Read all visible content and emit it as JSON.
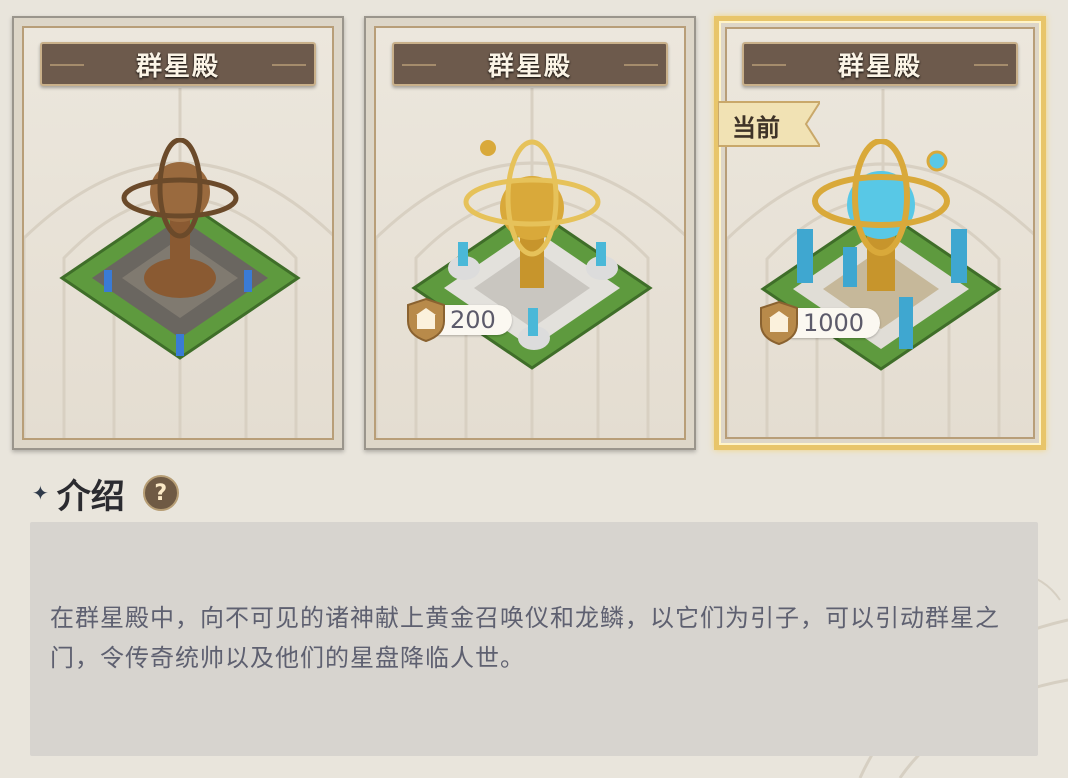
{
  "cards": [
    {
      "title": "群星殿",
      "cost": null,
      "selected": false
    },
    {
      "title": "群星殿",
      "cost": "200",
      "selected": false
    },
    {
      "title": "群星殿",
      "cost": "1000",
      "selected": true
    }
  ],
  "current_tag": "当前",
  "section": {
    "title": "介绍",
    "help_label": "?"
  },
  "description": "在群星殿中，向不可见的诸神献上黄金召唤仪和龙鳞，以它们为引子，可以引动群星之门，令传奇统帅以及他们的星盘降临人世。",
  "colors": {
    "selected_border": "#e8c56a",
    "banner": "#6d5a4c",
    "grass": "#5e9a3e",
    "crystal": "#4ab8d8",
    "gold": "#d9a93a",
    "bronze": "#9a6a3e"
  },
  "icons": {
    "cost_icon": "building-shield-icon",
    "help_icon": "question-icon",
    "bullet_icon": "diamond-icon"
  }
}
